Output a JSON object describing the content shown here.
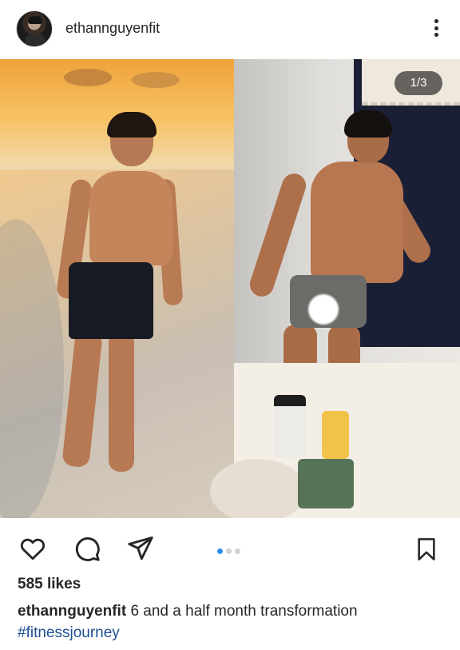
{
  "header": {
    "username": "ethannguyenfit",
    "avatar_icon": "profile-avatar",
    "more_icon": "more-vertical-icon"
  },
  "media": {
    "counter": "1/3",
    "carousel_position": 1,
    "carousel_total": 3,
    "left_photo": "beach-sunset-before-photo",
    "right_photo": "mirror-selfie-after-photo"
  },
  "actions": {
    "like_icon": "heart-icon",
    "comment_icon": "comment-bubble-icon",
    "share_icon": "paper-plane-icon",
    "save_icon": "bookmark-icon",
    "active_dot_color": "#2f8fe8"
  },
  "post": {
    "likes": "585 likes",
    "caption_user": "ethannguyenfit",
    "caption_text": "6 and a half month transformation",
    "hashtag": "#fitnessjourney",
    "hashtag_color": "#1f4f93"
  }
}
